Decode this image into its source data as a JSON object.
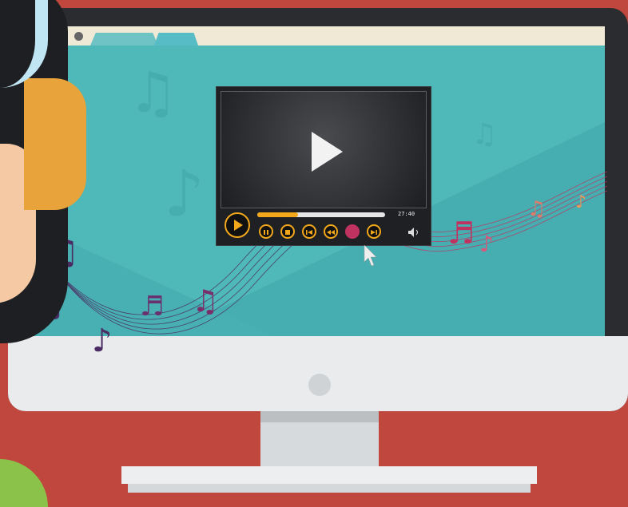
{
  "window": {
    "title_dots": [
      "pink",
      "gray"
    ]
  },
  "player": {
    "time_text": "27:40",
    "progress": 0.32,
    "controls": [
      "play",
      "pause",
      "stop",
      "previous",
      "rewind",
      "record",
      "next",
      "volume"
    ]
  },
  "icons": {
    "play": "play-icon",
    "pause": "pause-icon",
    "stop": "stop-icon",
    "previous": "previous-track-icon",
    "rewind": "rewind-icon",
    "next": "next-track-icon",
    "volume": "volume-icon",
    "cursor": "mouse-pointer-icon"
  },
  "colors": {
    "background": "#c0473e",
    "screen": "#4fb8b8",
    "accent": "#f3a81c",
    "notes_pink": "#c0325f",
    "notes_purple": "#4b2b63"
  }
}
